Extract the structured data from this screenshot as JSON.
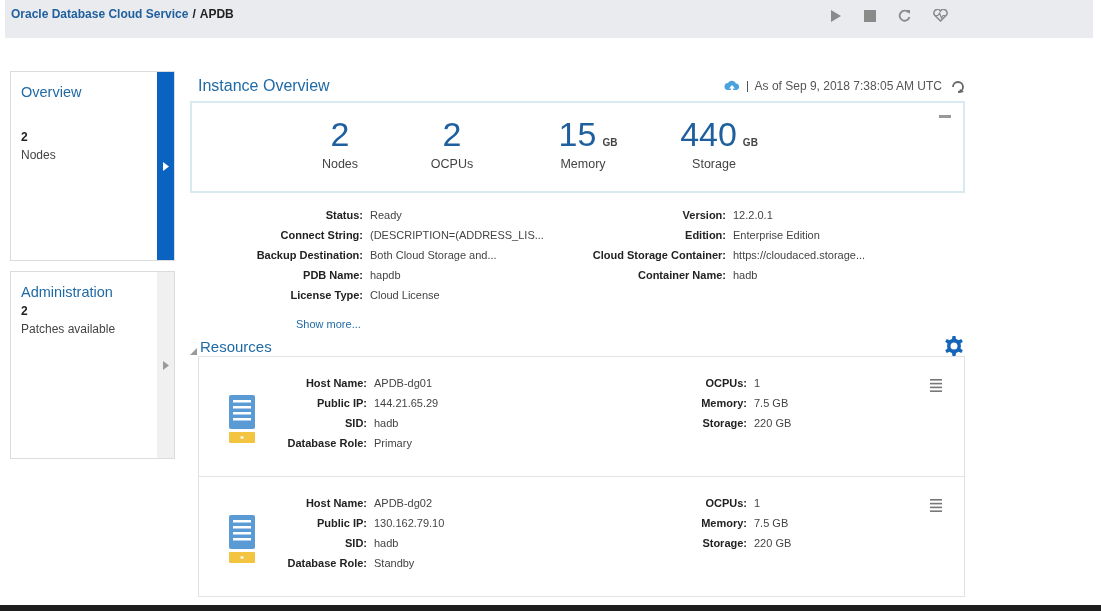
{
  "header": {
    "breadcrumb_link": "Oracle Database Cloud Service",
    "separator": "/",
    "current": "APDB"
  },
  "sidebar": [
    {
      "title": "Overview",
      "count": "2",
      "label": "Nodes",
      "selected": true
    },
    {
      "title": "Administration",
      "count": "2",
      "label": "Patches available",
      "selected": false
    }
  ],
  "overview": {
    "title": "Instance Overview",
    "timestamp": "As of Sep 9, 2018 7:38:05 AM UTC",
    "metrics": [
      {
        "value": "2",
        "label": "Nodes"
      },
      {
        "value": "2",
        "label": "OCPUs"
      },
      {
        "value": "15",
        "unit": "GB",
        "label": "Memory"
      },
      {
        "value": "440",
        "unit": "GB",
        "label": "Storage"
      }
    ]
  },
  "details_left": [
    {
      "label": "Status:",
      "value": "Ready"
    },
    {
      "label": "Connect String:",
      "value": "(DESCRIPTION=(ADDRESS_LIS..."
    },
    {
      "label": "Backup Destination:",
      "value": "Both Cloud Storage and..."
    },
    {
      "label": "PDB Name:",
      "value": "hapdb"
    },
    {
      "label": "License Type:",
      "value": "Cloud License"
    }
  ],
  "details_right": [
    {
      "label": "Version:",
      "value": "12.2.0.1"
    },
    {
      "label": "Edition:",
      "value": "Enterprise Edition"
    },
    {
      "label": "Cloud Storage Container:",
      "value": "https://cloudaced.storage..."
    },
    {
      "label": "Container Name:",
      "value": "hadb"
    }
  ],
  "show_more": "Show more...",
  "resources": {
    "title": "Resources",
    "nodes": [
      {
        "left": [
          {
            "label": "Host Name:",
            "value": "APDB-dg01"
          },
          {
            "label": "Public IP:",
            "value": "144.21.65.29"
          },
          {
            "label": "SID:",
            "value": "hadb"
          },
          {
            "label": "Database Role:",
            "value": "Primary"
          }
        ],
        "right": [
          {
            "label": "OCPUs:",
            "value": "1"
          },
          {
            "label": "Memory:",
            "value": "7.5 GB"
          },
          {
            "label": "Storage:",
            "value": "220 GB"
          }
        ]
      },
      {
        "left": [
          {
            "label": "Host Name:",
            "value": "APDB-dg02"
          },
          {
            "label": "Public IP:",
            "value": "130.162.79.10"
          },
          {
            "label": "SID:",
            "value": "hadb"
          },
          {
            "label": "Database Role:",
            "value": "Standby"
          }
        ],
        "right": [
          {
            "label": "OCPUs:",
            "value": "1"
          },
          {
            "label": "Memory:",
            "value": "7.5 GB"
          },
          {
            "label": "Storage:",
            "value": "220 GB"
          }
        ]
      }
    ]
  }
}
